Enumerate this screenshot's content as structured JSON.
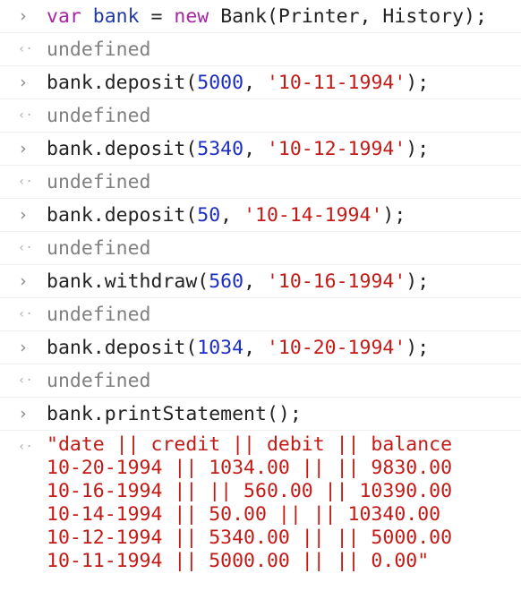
{
  "entries": [
    {
      "type": "input",
      "parts": [
        {
          "cls": "kw",
          "text": "var"
        },
        {
          "cls": "plain",
          "text": " "
        },
        {
          "cls": "ident",
          "text": "bank"
        },
        {
          "cls": "plain",
          "text": " = "
        },
        {
          "cls": "kw",
          "text": "new"
        },
        {
          "cls": "plain",
          "text": " Bank(Printer, History);"
        }
      ]
    },
    {
      "type": "result",
      "text": "undefined"
    },
    {
      "type": "input",
      "parts": [
        {
          "cls": "plain",
          "text": "bank.deposit("
        },
        {
          "cls": "num",
          "text": "5000"
        },
        {
          "cls": "plain",
          "text": ", "
        },
        {
          "cls": "str",
          "text": "'10-11-1994'"
        },
        {
          "cls": "plain",
          "text": ");"
        }
      ]
    },
    {
      "type": "result",
      "text": "undefined"
    },
    {
      "type": "input",
      "parts": [
        {
          "cls": "plain",
          "text": "bank.deposit("
        },
        {
          "cls": "num",
          "text": "5340"
        },
        {
          "cls": "plain",
          "text": ", "
        },
        {
          "cls": "str",
          "text": "'10-12-1994'"
        },
        {
          "cls": "plain",
          "text": ");"
        }
      ]
    },
    {
      "type": "result",
      "text": "undefined"
    },
    {
      "type": "input",
      "parts": [
        {
          "cls": "plain",
          "text": "bank.deposit("
        },
        {
          "cls": "num",
          "text": "50"
        },
        {
          "cls": "plain",
          "text": ", "
        },
        {
          "cls": "str",
          "text": "'10-14-1994'"
        },
        {
          "cls": "plain",
          "text": ");"
        }
      ]
    },
    {
      "type": "result",
      "text": "undefined"
    },
    {
      "type": "input",
      "parts": [
        {
          "cls": "plain",
          "text": "bank.withdraw("
        },
        {
          "cls": "num",
          "text": "560"
        },
        {
          "cls": "plain",
          "text": ", "
        },
        {
          "cls": "str",
          "text": "'10-16-1994'"
        },
        {
          "cls": "plain",
          "text": ");"
        }
      ]
    },
    {
      "type": "result",
      "text": "undefined"
    },
    {
      "type": "input",
      "parts": [
        {
          "cls": "plain",
          "text": "bank.deposit("
        },
        {
          "cls": "num",
          "text": "1034"
        },
        {
          "cls": "plain",
          "text": ", "
        },
        {
          "cls": "str",
          "text": "'10-20-1994'"
        },
        {
          "cls": "plain",
          "text": ");"
        }
      ]
    },
    {
      "type": "result",
      "text": "undefined"
    },
    {
      "type": "input",
      "parts": [
        {
          "cls": "plain",
          "text": "bank.printStatement();"
        }
      ]
    }
  ],
  "statement": {
    "lines": [
      "\"date || credit || debit || balance",
      "10-20-1994 || 1034.00 || || 9830.00",
      "10-16-1994 || || 560.00 || 10390.00",
      "10-14-1994 || 50.00 || || 10340.00",
      "10-12-1994 || 5340.00 || || 5000.00",
      "10-11-1994 || 5000.00 || || 0.00\""
    ]
  },
  "prompts": {
    "input_glyph": "›",
    "result_glyph": "‹·"
  },
  "colors": {
    "keyword": "#a626a4",
    "identifier": "#1f3aa8",
    "number": "#1c2dc2",
    "string": "#c41a16",
    "result": "#808080"
  }
}
